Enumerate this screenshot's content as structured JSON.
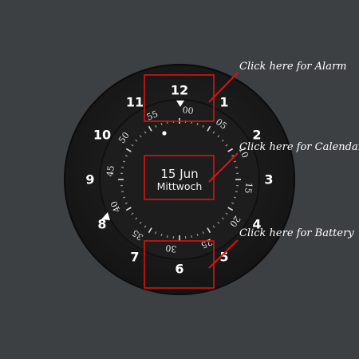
{
  "dial": {
    "hours": [
      "12",
      "1",
      "2",
      "3",
      "4",
      "5",
      "6",
      "7",
      "8",
      "9",
      "10",
      "11"
    ],
    "minutes": [
      "00",
      "05",
      "10",
      "15",
      "20",
      "25",
      "30",
      "35",
      "40",
      "45",
      "50",
      "55"
    ]
  },
  "date": {
    "day_month": "15 Jun",
    "weekday": "Mittwoch"
  },
  "hints": {
    "alarm": "Click here for Alarm",
    "calendar": "Click here for Calendar",
    "battery": "Click here for Battery"
  },
  "colors": {
    "background": "#3d4043",
    "highlight": "#dd1111"
  }
}
